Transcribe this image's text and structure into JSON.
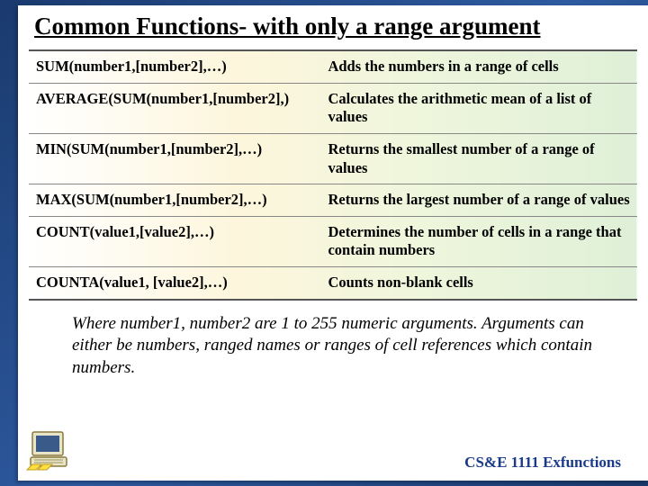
{
  "title": "Common Functions- with only a range argument",
  "rows": [
    {
      "fn": "SUM(number1,[number2],…)",
      "desc": "Adds the numbers in a range of cells"
    },
    {
      "fn": "AVERAGE(SUM(number1,[number2],)",
      "desc": "Calculates the arithmetic mean of a list of values"
    },
    {
      "fn": "MIN(SUM(number1,[number2],…)",
      "desc": "Returns the smallest number of a range of values"
    },
    {
      "fn": "MAX(SUM(number1,[number2],…)",
      "desc": "Returns the largest number of a range of values"
    },
    {
      "fn": "COUNT(value1,[value2],…)",
      "desc": "Determines the number of cells in a range that contain numbers"
    },
    {
      "fn": "COUNTA(value1, [value2],…)",
      "desc": "Counts non-blank cells"
    }
  ],
  "note": "Where number1, number2 are 1 to 255 numeric arguments. Arguments can either be numbers, ranged names or ranges of cell references which contain numbers.",
  "footer": "CS&E 1111  Exfunctions"
}
